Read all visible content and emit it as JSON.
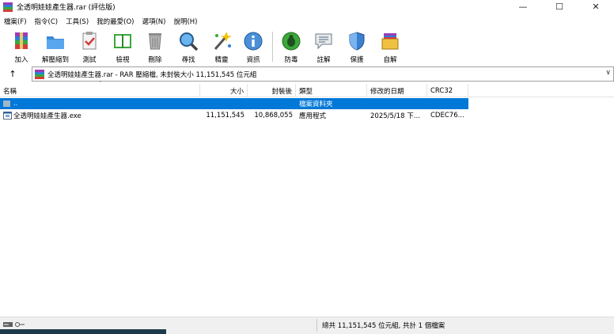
{
  "window": {
    "title": "全透明娃娃產生器.rar (評估版)",
    "minimize": "—",
    "maximize": "☐",
    "close": "✕"
  },
  "menu": [
    "檔案(F)",
    "指令(C)",
    "工具(S)",
    "我的最愛(O)",
    "選項(N)",
    "說明(H)"
  ],
  "toolbar": {
    "add": "加入",
    "extract_to": "解壓縮到",
    "test": "測試",
    "view": "檢視",
    "delete": "刪除",
    "find": "尋找",
    "wizard": "精靈",
    "info": "資訊",
    "virus_scan": "防毒",
    "comment": "註解",
    "protect": "保護",
    "sfx": "自解"
  },
  "address": {
    "up": "↑",
    "text": "全透明娃娃產生器.rar - RAR 壓縮檔, 未封裝大小 11,151,545 位元組",
    "dropdown": "∨"
  },
  "columns": {
    "name": "名稱",
    "size": "大小",
    "packed": "封裝後",
    "type": "類型",
    "modified": "修改的日期",
    "crc": "CRC32",
    "sort_indicator": "⌃"
  },
  "rows": [
    {
      "name": "..",
      "size": "",
      "packed": "",
      "type": "檔案資料夾",
      "modified": "",
      "crc": ""
    },
    {
      "name": "全透明娃娃產生器.exe",
      "size": "11,151,545",
      "packed": "10,868,055",
      "type": "應用程式",
      "modified": "2025/5/18 下...",
      "crc": "CDEC76..."
    }
  ],
  "status": {
    "summary": "總共 11,151,545 位元組, 共計 1 個檔案"
  },
  "colors": {
    "selection": "#0078d7",
    "folder_icon": "#7f9db9"
  }
}
